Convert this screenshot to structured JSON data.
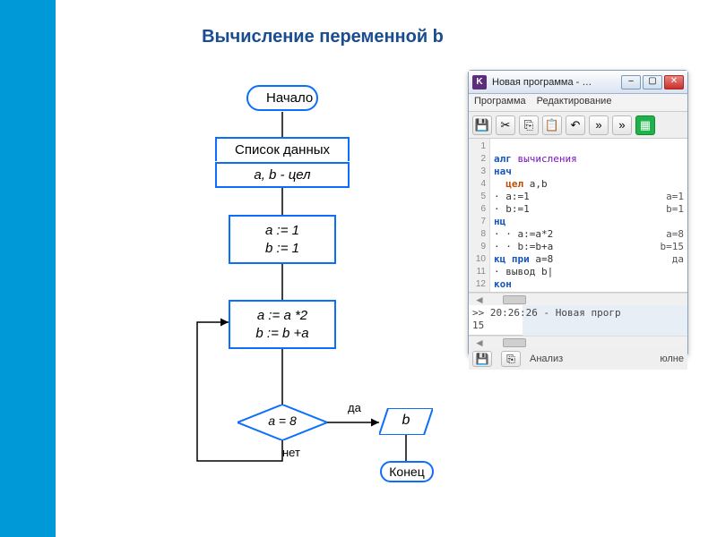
{
  "title": "Вычисление переменной b",
  "flow": {
    "start": "Начало",
    "data_label": "Список данных",
    "data_type": "a, b - цел",
    "init": "a := 1\nb := 1",
    "loop_body": "a := a *2\nb := b +a",
    "condition": "a = 8",
    "yes": "да",
    "no": "нет",
    "output_var": "b",
    "end": "Конец"
  },
  "ide": {
    "app_icon_letter": "K",
    "window_title": "Новая программа - …",
    "menu": {
      "program": "Программа",
      "edit": "Редактирование"
    },
    "toolbar_overflow": "»",
    "line_numbers": [
      "1",
      "2",
      "3",
      "4",
      "5",
      "6",
      "7",
      "8",
      "9",
      "10",
      "11",
      "12"
    ],
    "code": {
      "l1_kw": "алг",
      "l1_name": "вычисления",
      "l2_kw": "нач",
      "l3_ty": "цел",
      "l3_vars": "a,b",
      "l4": "· a:=1",
      "l5": "· b:=1",
      "l6_kw": "нц",
      "l7": "· · a:=a*2",
      "l8": "· · b:=b+a",
      "l9_kw": "кц при",
      "l9_cond": "a=8",
      "l10": "· вывод b|",
      "l11_kw": "кон"
    },
    "trace": {
      "t4": "a=1",
      "t5": "b=1",
      "t7": "a=8",
      "t8": "b=15",
      "t9": "да"
    },
    "console_line1": ">> 20:26:26 - Новая прогр",
    "console_line2": "15",
    "status": {
      "analysis": "Анализ",
      "full": "юлне"
    }
  }
}
